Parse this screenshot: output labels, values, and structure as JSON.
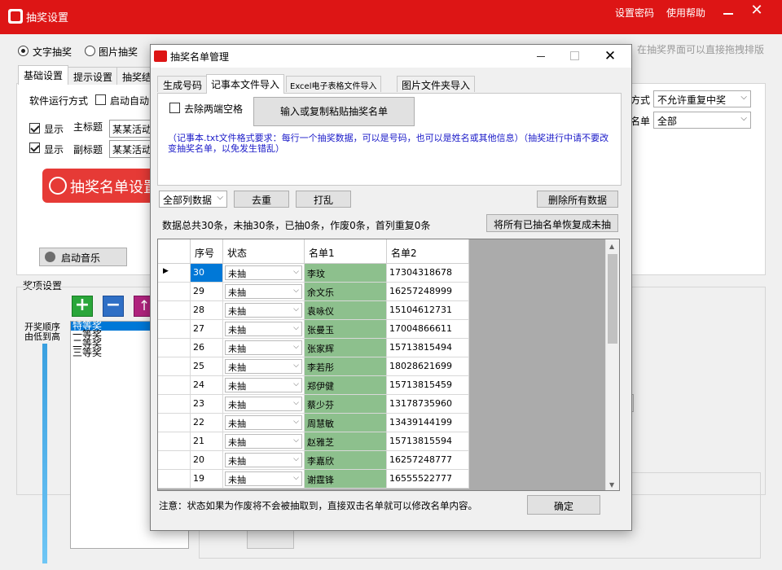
{
  "app": {
    "title": "抽奖设置",
    "settings_link": "设置密码",
    "help_link": "使用帮助"
  },
  "main": {
    "mode_text": "文字抽奖",
    "mode_image": "图片抽奖",
    "hint_right": "在抽奖界面可以直接拖拽排版",
    "tabs": [
      "基础设置",
      "提示设置",
      "抽奖结"
    ],
    "run_mode_label": "软件运行方式",
    "auto_label": "启动自动",
    "show1": "显示",
    "main_title_label": "主标题",
    "main_title_value": "某某活动",
    "show2": "显示",
    "sub_title_label": "副标题",
    "sub_title_value": "某某活动",
    "list_btn": "抽奖名单设置",
    "music_btn": "启动音乐",
    "right_label1": "方式",
    "right_combo1": "不允许重复中奖",
    "right_label2": "名单",
    "right_combo2": "全部",
    "prize_section": "奖项设置",
    "order_text": "开奖顺序\n由低到高",
    "prizes": [
      "特等奖",
      "一等奖",
      "二等奖",
      "三等奖"
    ]
  },
  "dialog": {
    "title": "抽奖名单管理",
    "tabs": [
      "生成号码",
      "记事本文件导入",
      "Excel电子表格文件导入",
      "图片文件夹导入"
    ],
    "trim_label": "去除两端空格",
    "paste_btn": "输入或复制粘贴抽奖名单",
    "note": "（记事本.txt文件格式要求：每行一个抽奖数据，可以是号码，也可以是姓名或其他信息）（抽奖进行中请不要改变抽奖名单，以免发生错乱）",
    "filter": "全部列数据",
    "dedupe_btn": "去重",
    "shuffle_btn": "打乱",
    "delete_btn": "删除所有数据",
    "restore_btn": "将所有已抽名单恢复成未抽",
    "stats": "数据总共30条，未抽30条，已抽0条，作废0条，首列重复0条",
    "headers": [
      "序号",
      "状态",
      "名单1",
      "名单2"
    ],
    "rows": [
      [
        "30",
        "未抽",
        "李玟",
        "17304318678"
      ],
      [
        "29",
        "未抽",
        "余文乐",
        "16257248999"
      ],
      [
        "28",
        "未抽",
        "袁咏仪",
        "15104612731"
      ],
      [
        "27",
        "未抽",
        "张曼玉",
        "17004866611"
      ],
      [
        "26",
        "未抽",
        "张家辉",
        "15713815494"
      ],
      [
        "25",
        "未抽",
        "李若彤",
        "18028621699"
      ],
      [
        "24",
        "未抽",
        "郑伊健",
        "15713815459"
      ],
      [
        "23",
        "未抽",
        "蔡少芬",
        "13178735960"
      ],
      [
        "22",
        "未抽",
        "周慧敏",
        "13439144199"
      ],
      [
        "21",
        "未抽",
        "赵雅芝",
        "15713815594"
      ],
      [
        "20",
        "未抽",
        "李嘉欣",
        "16257248777"
      ],
      [
        "19",
        "未抽",
        "谢霆锋",
        "16555522777"
      ]
    ],
    "footer_note": "注意：状态如果为作废将不会被抽取到，直接双击名单就可以修改名单内容。",
    "ok_btn": "确定"
  }
}
